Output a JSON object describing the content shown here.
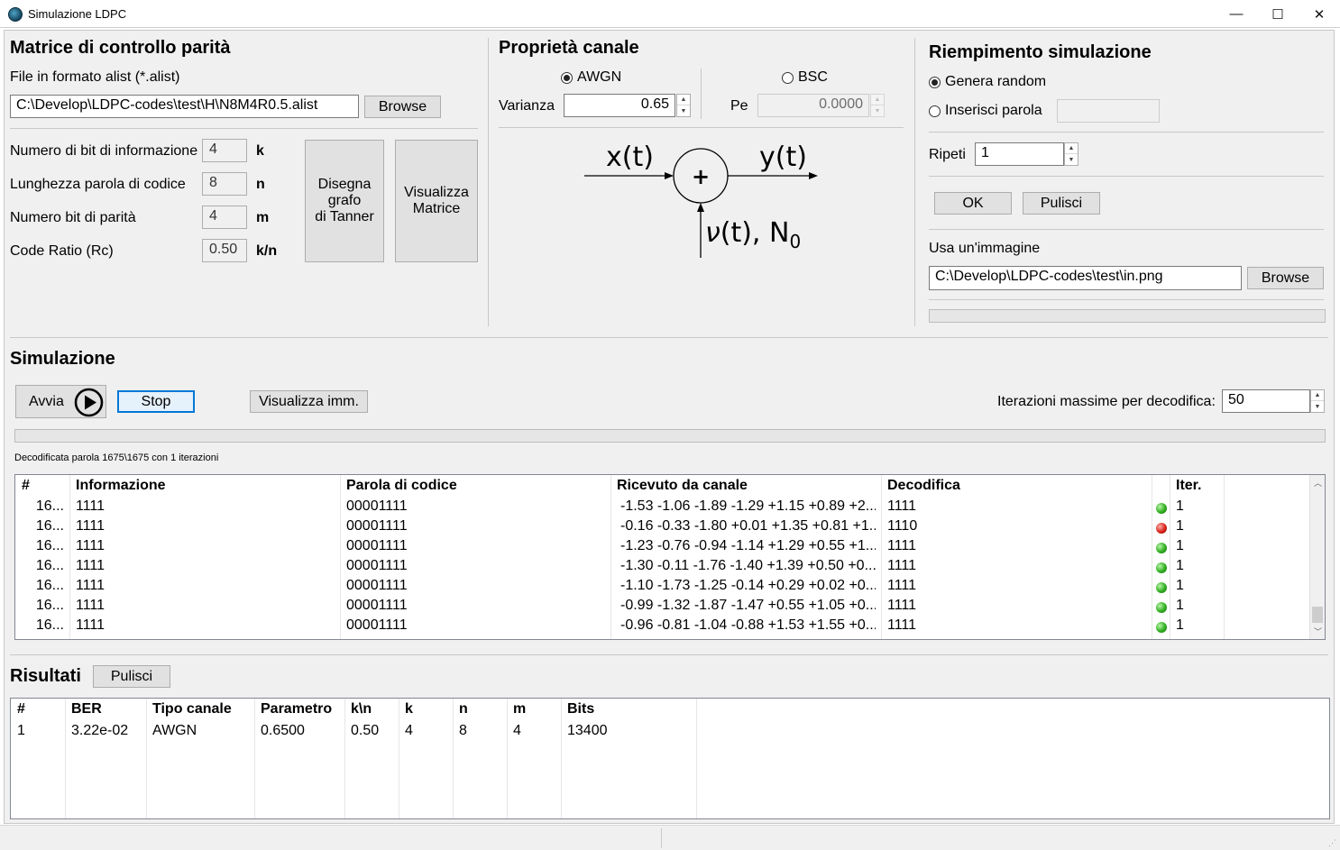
{
  "window": {
    "title": "Simulazione LDPC",
    "controls": {
      "minimize": "—",
      "maximize": "☐",
      "close": "✕"
    }
  },
  "parity": {
    "title": "Matrice di controllo parità",
    "file_label": "File in formato alist (*.alist)",
    "file_path": "C:\\Develop\\LDPC-codes\\test\\H\\N8M4R0.5.alist",
    "browse_label": "Browse",
    "params": [
      {
        "label": "Numero di bit di informazione",
        "value": "4",
        "unit": "k"
      },
      {
        "label": "Lunghezza parola di codice",
        "value": "8",
        "unit": "n"
      },
      {
        "label": "Numero bit di parità",
        "value": "4",
        "unit": "m"
      },
      {
        "label": "Code Ratio (Rc)",
        "value": "0.50",
        "unit": "k/n"
      }
    ],
    "tanner_button": "Disegna\ngrafo\ndi Tanner",
    "matrix_button": "Visualizza\nMatrice"
  },
  "channel": {
    "title": "Proprietà canale",
    "awgn_label": "AWGN",
    "awgn_selected": true,
    "bsc_label": "BSC",
    "bsc_selected": false,
    "variance_label": "Varianza",
    "variance_value": "0.65",
    "pe_label": "Pe",
    "pe_value": "0.0000",
    "diagram": {
      "input": "x(t)",
      "output": "y(t)",
      "adder": "+",
      "noise_symbol": "ν",
      "noise_rest": "(t), N",
      "noise_sub": "0"
    }
  },
  "fill": {
    "title": "Riempimento simulazione",
    "random_label": "Genera random",
    "random_selected": true,
    "insert_label": "Inserisci parola",
    "insert_selected": false,
    "insert_value": "",
    "repeat_label": "Ripeti",
    "repeat_value": "1",
    "ok_label": "OK",
    "clear_label": "Pulisci",
    "image_label": "Usa un'immagine",
    "image_path": "C:\\Develop\\LDPC-codes\\test\\in.png",
    "browse_label": "Browse",
    "progress": 0
  },
  "simulation": {
    "title": "Simulazione",
    "start_label": "Avvia",
    "stop_label": "Stop",
    "view_image_label": "Visualizza imm.",
    "max_iter_label": "Iterazioni massime per decodifica:",
    "max_iter_value": "50",
    "progress": 0,
    "status": "Decodificata parola 1675\\1675 con 1 iterazioni",
    "columns": [
      "#",
      "Informazione",
      "Parola di codice",
      "Ricevuto da canale",
      "Decodifica",
      "",
      "Iter."
    ],
    "rows": [
      {
        "num": "16...",
        "info": "1111",
        "code": "00001111",
        "received": "-1.53 -1.06 -1.89 -1.29 +1.15 +0.89 +2....",
        "decoded": "1111",
        "status": "ok",
        "iter": "1"
      },
      {
        "num": "16...",
        "info": "1111",
        "code": "00001111",
        "received": "-0.16 -0.33 -1.80 +0.01 +1.35 +0.81 +1...",
        "decoded": "1110",
        "status": "error",
        "iter": "1"
      },
      {
        "num": "16...",
        "info": "1111",
        "code": "00001111",
        "received": "-1.23 -0.76 -0.94 -1.14 +1.29 +0.55 +1....",
        "decoded": "1111",
        "status": "ok",
        "iter": "1"
      },
      {
        "num": "16...",
        "info": "1111",
        "code": "00001111",
        "received": "-1.30 -0.11 -1.76 -1.40 +1.39 +0.50 +0....",
        "decoded": "1111",
        "status": "ok",
        "iter": "1"
      },
      {
        "num": "16...",
        "info": "1111",
        "code": "00001111",
        "received": "-1.10 -1.73 -1.25 -0.14 +0.29 +0.02 +0....",
        "decoded": "1111",
        "status": "ok",
        "iter": "1"
      },
      {
        "num": "16...",
        "info": "1111",
        "code": "00001111",
        "received": "-0.99 -1.32 -1.87 -1.47 +0.55 +1.05 +0....",
        "decoded": "1111",
        "status": "ok",
        "iter": "1"
      },
      {
        "num": "16...",
        "info": "1111",
        "code": "00001111",
        "received": "-0.96 -0.81 -1.04 -0.88 +1.53 +1.55 +0....",
        "decoded": "1111",
        "status": "ok",
        "iter": "1"
      }
    ],
    "status_colors": {
      "ok": "#2fae1f",
      "error": "#d8231a"
    }
  },
  "results": {
    "title": "Risultati",
    "clear_label": "Pulisci",
    "columns": [
      "#",
      "BER",
      "Tipo canale",
      "Parametro",
      "k\\n",
      "k",
      "n",
      "m",
      "Bits"
    ],
    "rows": [
      [
        "1",
        "3.22e-02",
        "AWGN",
        "0.6500",
        "0.50",
        "4",
        "8",
        "4",
        "13400"
      ]
    ]
  }
}
